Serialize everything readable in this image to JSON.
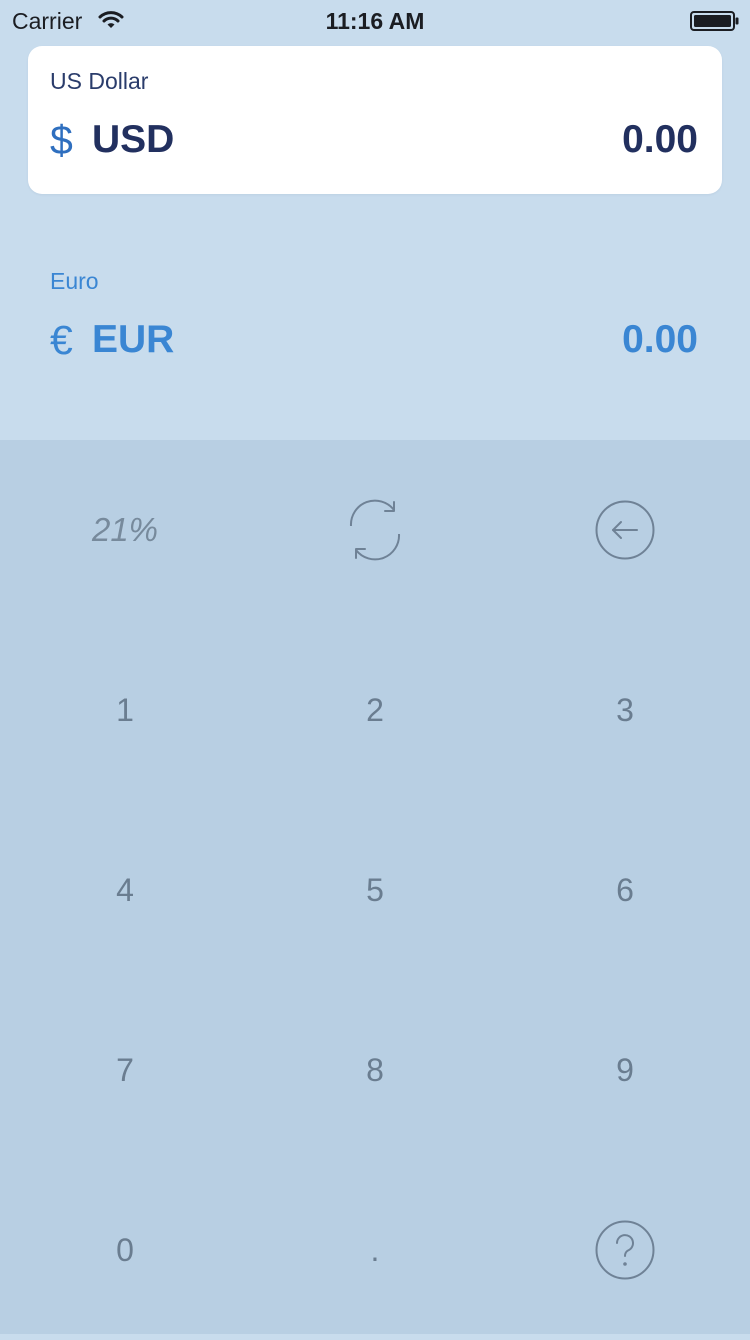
{
  "status_bar": {
    "carrier": "Carrier",
    "time": "11:16 AM",
    "wifi_icon": "wifi-icon",
    "battery_icon": "battery-icon"
  },
  "from_currency": {
    "name": "US Dollar",
    "symbol": "$",
    "code": "USD",
    "amount": "0.00"
  },
  "to_currency": {
    "name": "Euro",
    "symbol": "€",
    "code": "EUR",
    "amount": "0.00"
  },
  "keypad": {
    "percent_label": "21%",
    "swap_icon": "swap-arrows-icon",
    "backspace_icon": "backspace-circle-arrow-icon",
    "help_icon": "help-circle-question-icon",
    "digits": [
      "1",
      "2",
      "3",
      "4",
      "5",
      "6",
      "7",
      "8",
      "9"
    ],
    "zero": "0",
    "decimal": "."
  },
  "colors": {
    "background": "#c8dced",
    "keypad_background": "#b8cfe3",
    "from_text": "#22305f",
    "to_text": "#3a86d3",
    "key_text": "#6a7d90"
  }
}
